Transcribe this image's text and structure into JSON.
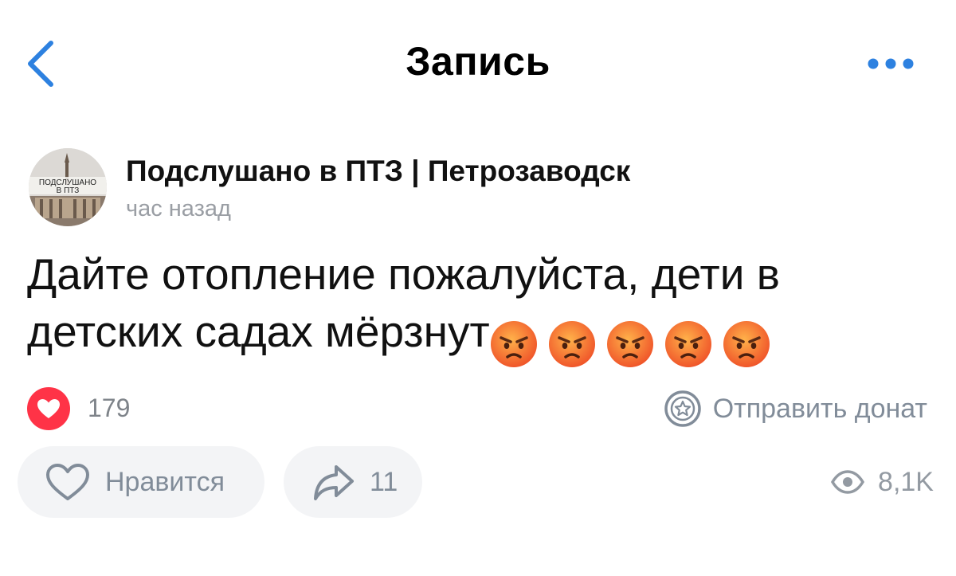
{
  "header": {
    "title": "Запись",
    "back_icon": "chevron-left-icon",
    "more_icon": "more-horizontal-icon"
  },
  "post": {
    "author": "Подслушано в ПТЗ | Петрозаводск",
    "avatar_text_line1": "ПОДСЛУШАНО",
    "avatar_text_line2": "В ПТЗ",
    "time": "час назад",
    "text": "Дайте отопление пожалуйста, дети в детских садах мёрзнут",
    "emoji": [
      "angry-face-emoji",
      "angry-face-emoji",
      "angry-face-emoji",
      "angry-face-emoji",
      "angry-face-emoji"
    ]
  },
  "reactions": {
    "icon": "heart-reaction-icon",
    "count": "179"
  },
  "donate": {
    "label": "Отправить донат",
    "icon": "star-coin-icon"
  },
  "actions": {
    "like_label": "Нравится",
    "share_count": "11",
    "views": "8,1K"
  },
  "colors": {
    "accent": "#2d81e0",
    "heart": "#ff3347",
    "secondary_text": "#818c99",
    "pill_bg": "#f3f4f6"
  }
}
